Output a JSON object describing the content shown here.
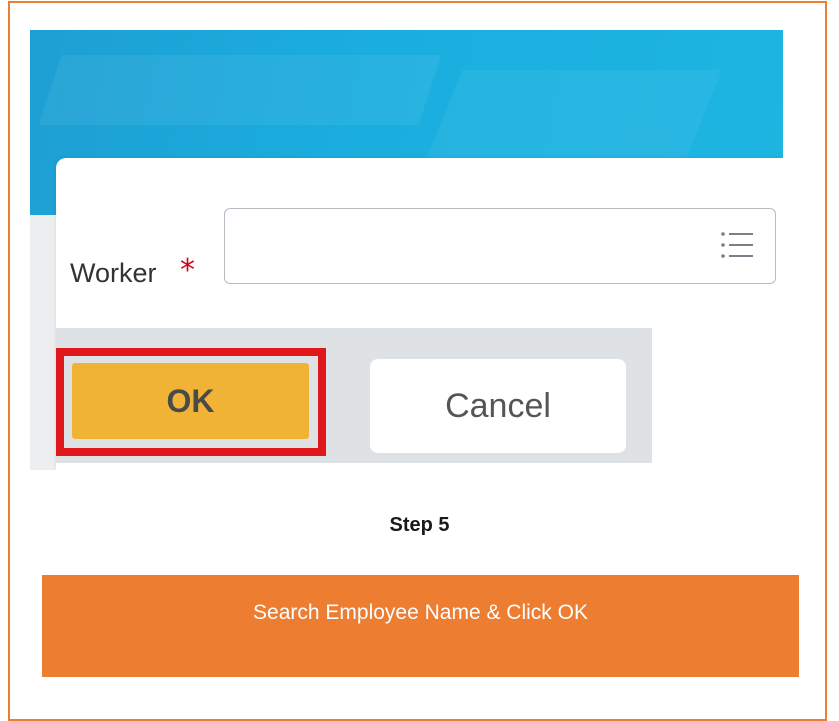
{
  "dialog": {
    "field_label": "Worker",
    "required_marker": "*",
    "input_value": "",
    "input_icon": "list-icon"
  },
  "buttons": {
    "ok_label": "OK",
    "cancel_label": "Cancel"
  },
  "annotation": {
    "step_label": "Step 5",
    "caption": "Search Employee Name & Click OK",
    "highlight_color": "#e0181c",
    "banner_color": "#ec7d31"
  },
  "colors": {
    "header_blue": "#1aaedf",
    "ok_button": "#f0b336",
    "required_star": "#d0021b",
    "button_bar": "#dfe2e5"
  }
}
